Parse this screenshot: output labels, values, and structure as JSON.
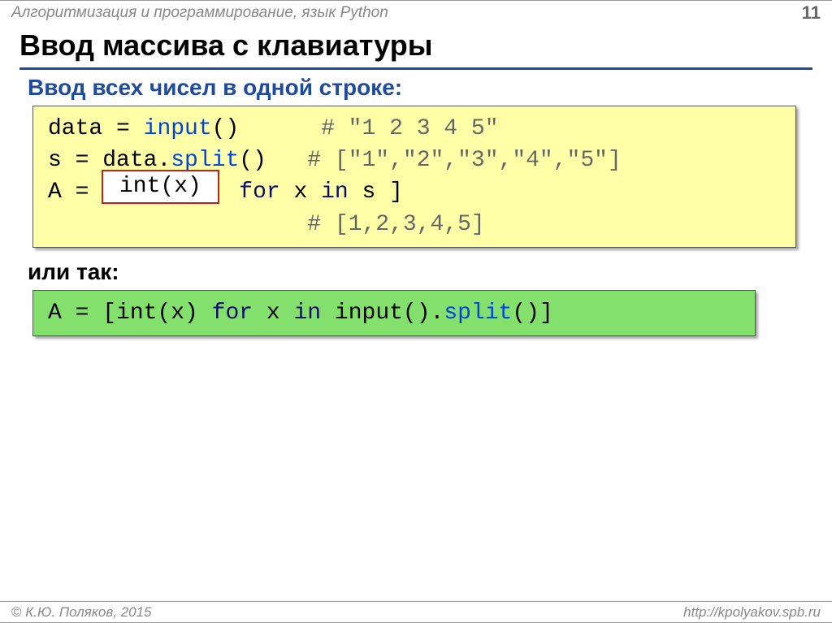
{
  "header": {
    "course": "Алгоритмизация и программирование, язык Python",
    "page": "11"
  },
  "title": "Ввод массива с клавиатуры",
  "sub1": "Ввод всех чисел в одной строке:",
  "code1": {
    "l1a": "data",
    "l1eq": " = ",
    "l1b": "input",
    "l1c": "()      ",
    "l1d": "# \"1 2 3 4 5\"",
    "l2a": "s",
    "l2eq": " = ",
    "l2b": "data.",
    "l2c": "split",
    "l2d": "()   ",
    "l2e": "# [\"1\",\"2\",\"3\",\"4\",\"5\"]",
    "l3a": "A",
    "l3eq": " = ",
    "l3b": "[         ",
    "l3c": "for",
    "l3d": " x ",
    "l3e": "in",
    "l3f": " s ]",
    "l4sp": "                   ",
    "l4a": "# [1,2,3,4,5]",
    "highlight": "int(x)"
  },
  "sub2": "или так:",
  "code2": {
    "a": "A",
    "eq": " = ",
    "b": "[int(x) ",
    "c": "for",
    "d": " x ",
    "e": "in",
    "f": " input().",
    "g": "split",
    "h": "()]"
  },
  "footer": {
    "copyright": " К.Ю. Поляков, 2015",
    "url": "http://kpolyakov.spb.ru"
  }
}
